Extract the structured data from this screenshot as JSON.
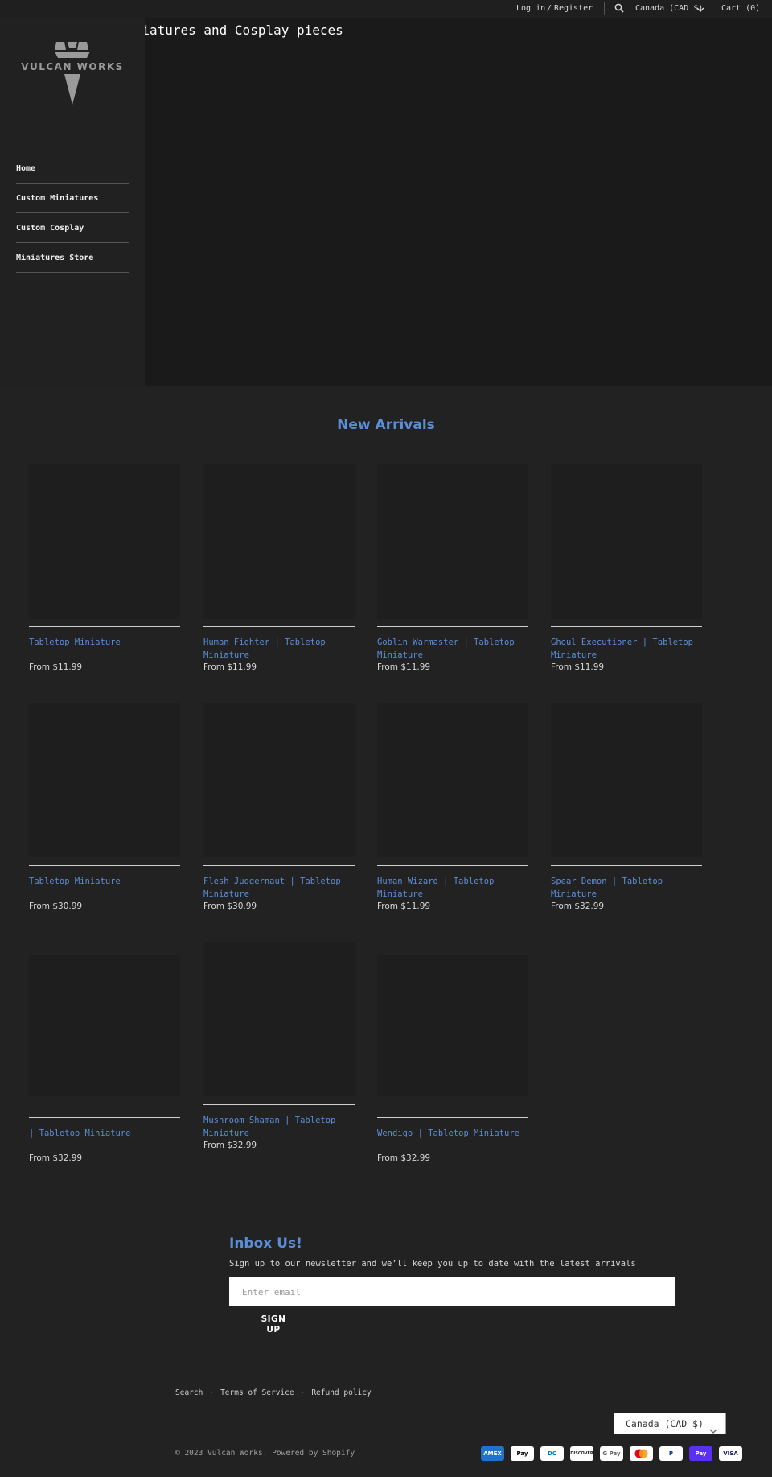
{
  "header": {
    "login_label": "Log in",
    "divider": "/",
    "register_label": "Register",
    "search_icon": "search-icon",
    "currency_label": "Canada (CAD $)",
    "cart_label": "Cart (0)"
  },
  "brand": {
    "logo_text": "VULCAN WORKS"
  },
  "hero": {
    "title": "Custom Miniatures and Cosplay pieces"
  },
  "nav": {
    "items": [
      {
        "label": "Home"
      },
      {
        "label": "Custom Miniatures"
      },
      {
        "label": "Custom Cosplay"
      },
      {
        "label": "Miniatures Store"
      }
    ]
  },
  "new_arrivals": {
    "title": "New Arrivals",
    "products": [
      {
        "name": "Tabletop Miniature",
        "price": "From $11.99"
      },
      {
        "name": "Human Fighter | Tabletop Miniature",
        "price": "From $11.99"
      },
      {
        "name": "Goblin Warmaster | Tabletop Miniature",
        "price": "From $11.99"
      },
      {
        "name": "Ghoul Executioner | Tabletop Miniature",
        "price": "From $11.99"
      },
      {
        "name": "Tabletop Miniature",
        "price": "From $30.99"
      },
      {
        "name": "Flesh Juggernaut | Tabletop Miniature",
        "price": "From $30.99"
      },
      {
        "name": "Human Wizard | Tabletop Miniature",
        "price": "From $11.99"
      },
      {
        "name": "Spear Demon | Tabletop Miniature",
        "price": "From $32.99"
      },
      {
        "name": "| Tabletop Miniature",
        "price": "From $32.99"
      },
      {
        "name": "Mushroom Shaman | Tabletop Miniature",
        "price": "From $32.99"
      },
      {
        "name": "Wendigo | Tabletop Miniature",
        "price": "From $32.99"
      }
    ]
  },
  "newsletter": {
    "title": "Inbox Us!",
    "subtitle": "Sign up to our newsletter and we’ll keep you up to date with the latest arrivals",
    "email_placeholder": "Enter email",
    "button_line1": "SIGN",
    "button_line2": "UP"
  },
  "footer": {
    "links": [
      "Search",
      "Terms of Service",
      "Refund policy"
    ],
    "separator": "·",
    "copyright": "© 2023 Vulcan Works. Powered by Shopify",
    "currency_selector": "Canada (CAD $)",
    "payment_icons": [
      {
        "icon": "amex-icon",
        "label": "AMEX",
        "bg": "#1f72cd",
        "fg": "#ffffff"
      },
      {
        "icon": "apple-pay-icon",
        "label": "Pay",
        "bg": "#ffffff",
        "fg": "#000000"
      },
      {
        "icon": "diners-club-icon",
        "label": "DC",
        "bg": "#ffffff",
        "fg": "#0079be"
      },
      {
        "icon": "discover-icon",
        "label": "DISCOVER",
        "bg": "#ffffff",
        "fg": "#222222"
      },
      {
        "icon": "google-pay-icon",
        "label": "G Pay",
        "bg": "#ffffff",
        "fg": "#5f6368"
      },
      {
        "icon": "mastercard-icon",
        "label": "",
        "bg": "#ffffff",
        "fg": "#000000"
      },
      {
        "icon": "paypal-icon",
        "label": "P",
        "bg": "#ffffff",
        "fg": "#003087"
      },
      {
        "icon": "shop-pay-icon",
        "label": "Pay",
        "bg": "#5a31f4",
        "fg": "#ffffff"
      },
      {
        "icon": "visa-icon",
        "label": "VISA",
        "bg": "#ffffff",
        "fg": "#1a1f71"
      }
    ]
  },
  "colors": {
    "background": "#222222",
    "accent_blue": "#5b8ed6",
    "hero_bg": "#1a1a1a",
    "sidebar_bg": "#212121"
  }
}
